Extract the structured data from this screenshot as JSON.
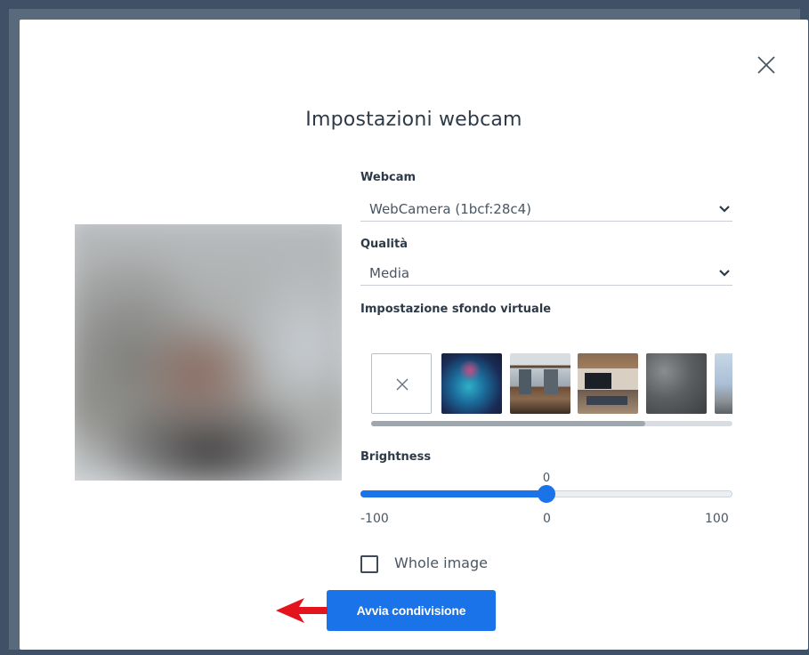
{
  "dialog": {
    "title": "Impostazioni webcam",
    "close_icon": "close-icon"
  },
  "webcam": {
    "label": "Webcam",
    "selected": "WebCamera (1bcf:28c4)"
  },
  "quality": {
    "label": "Qualità",
    "selected": "Media"
  },
  "virtual_background": {
    "label": "Impostazione sfondo virtuale",
    "options": [
      "none-icon",
      "aurora",
      "office-windows",
      "office-tv",
      "stone-texture",
      "city-view"
    ]
  },
  "brightness": {
    "label": "Brightness",
    "value": "0",
    "min": "-100",
    "mid": "0",
    "max": "100",
    "value_num": 0,
    "min_num": -100,
    "max_num": 100
  },
  "whole_image": {
    "label": "Whole image",
    "checked": false
  },
  "actions": {
    "start_sharing": "Avvia condivisione"
  },
  "colors": {
    "accent": "#1a73e8",
    "annotation_arrow": "#e3141c"
  }
}
